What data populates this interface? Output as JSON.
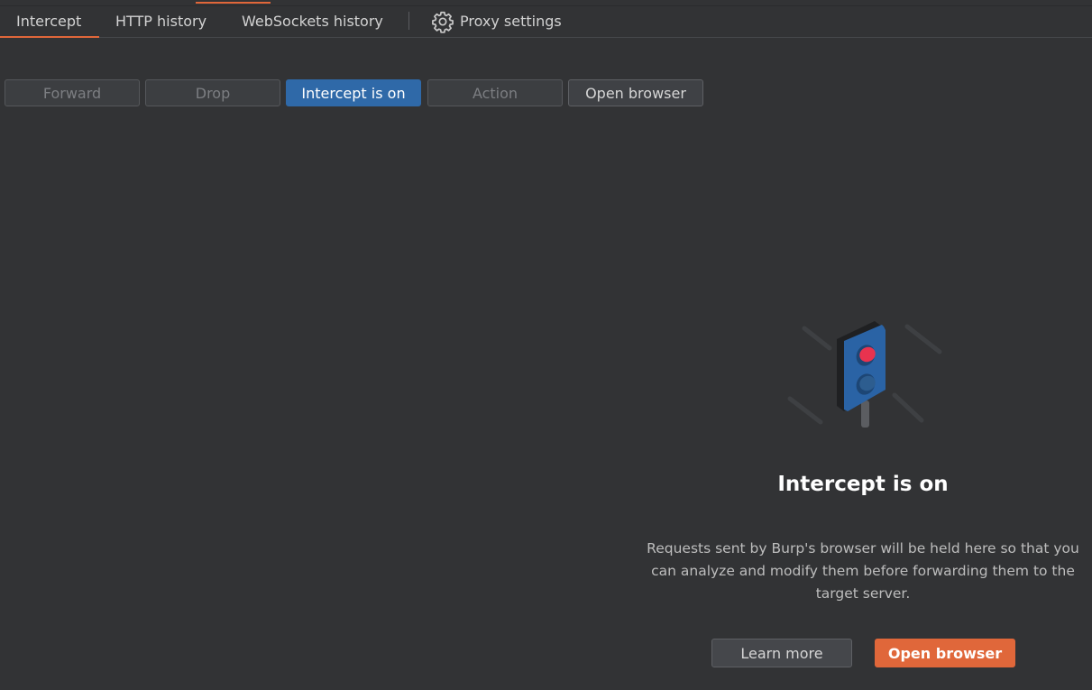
{
  "tabs": [
    {
      "label": "Intercept",
      "active": true
    },
    {
      "label": "HTTP history",
      "active": false
    },
    {
      "label": "WebSockets history",
      "active": false
    },
    {
      "label": "Proxy settings",
      "active": false,
      "icon": "gear-icon"
    }
  ],
  "toolbar": {
    "forward_label": "Forward",
    "drop_label": "Drop",
    "intercept_label": "Intercept is on",
    "action_label": "Action",
    "open_browser_label": "Open browser"
  },
  "empty_state": {
    "icon": "traffic-light-icon",
    "title": "Intercept is on",
    "description": "Requests sent by Burp's browser will be held here so that you can analyze and modify them before forwarding them to the target server.",
    "learn_more_label": "Learn more",
    "open_browser_label": "Open browser"
  },
  "colors": {
    "background": "#323335",
    "accent": "#e0673a",
    "primary_blue": "#2f69a8",
    "light_red": "#e8334f"
  }
}
